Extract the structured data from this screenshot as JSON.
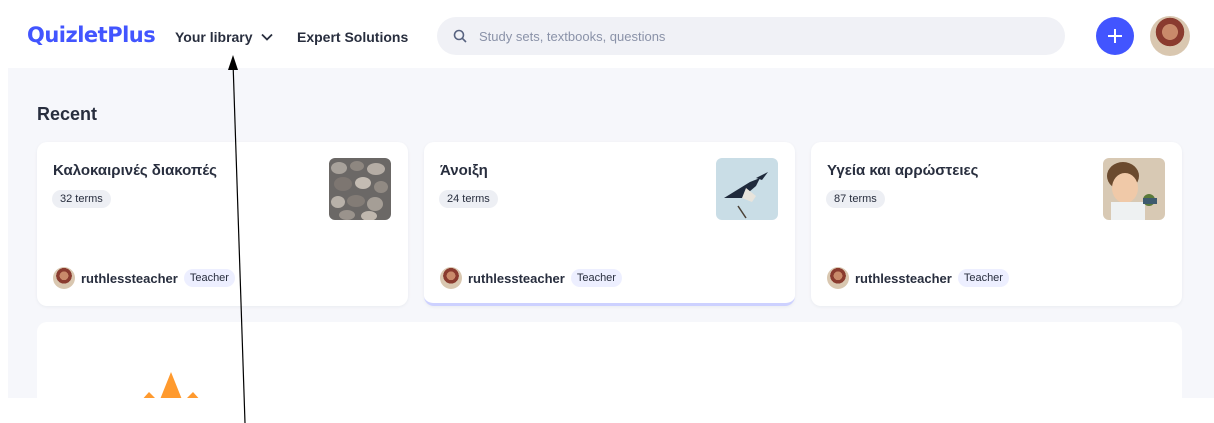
{
  "header": {
    "logo": "QuizletPlus",
    "nav_library": "Your library",
    "nav_expert": "Expert Solutions",
    "search_placeholder": "Study sets, textbooks, questions"
  },
  "recent": {
    "title": "Recent",
    "cards": [
      {
        "title": "Καλοκαιρινές διακοπές",
        "terms": "32 terms",
        "author": "ruthlessteacher",
        "role": "Teacher",
        "thumb": "pebbles-image"
      },
      {
        "title": "Άνοιξη",
        "terms": "24 terms",
        "author": "ruthlessteacher",
        "role": "Teacher",
        "thumb": "swallow-image"
      },
      {
        "title": "Υγεία και αρρώστειες",
        "terms": "87 terms",
        "author": "ruthlessteacher",
        "role": "Teacher",
        "thumb": "child-image"
      }
    ]
  },
  "colors": {
    "brand": "#4255ff",
    "background": "#f6f7fb",
    "text": "#282e3e",
    "badge": "#edeff4"
  }
}
